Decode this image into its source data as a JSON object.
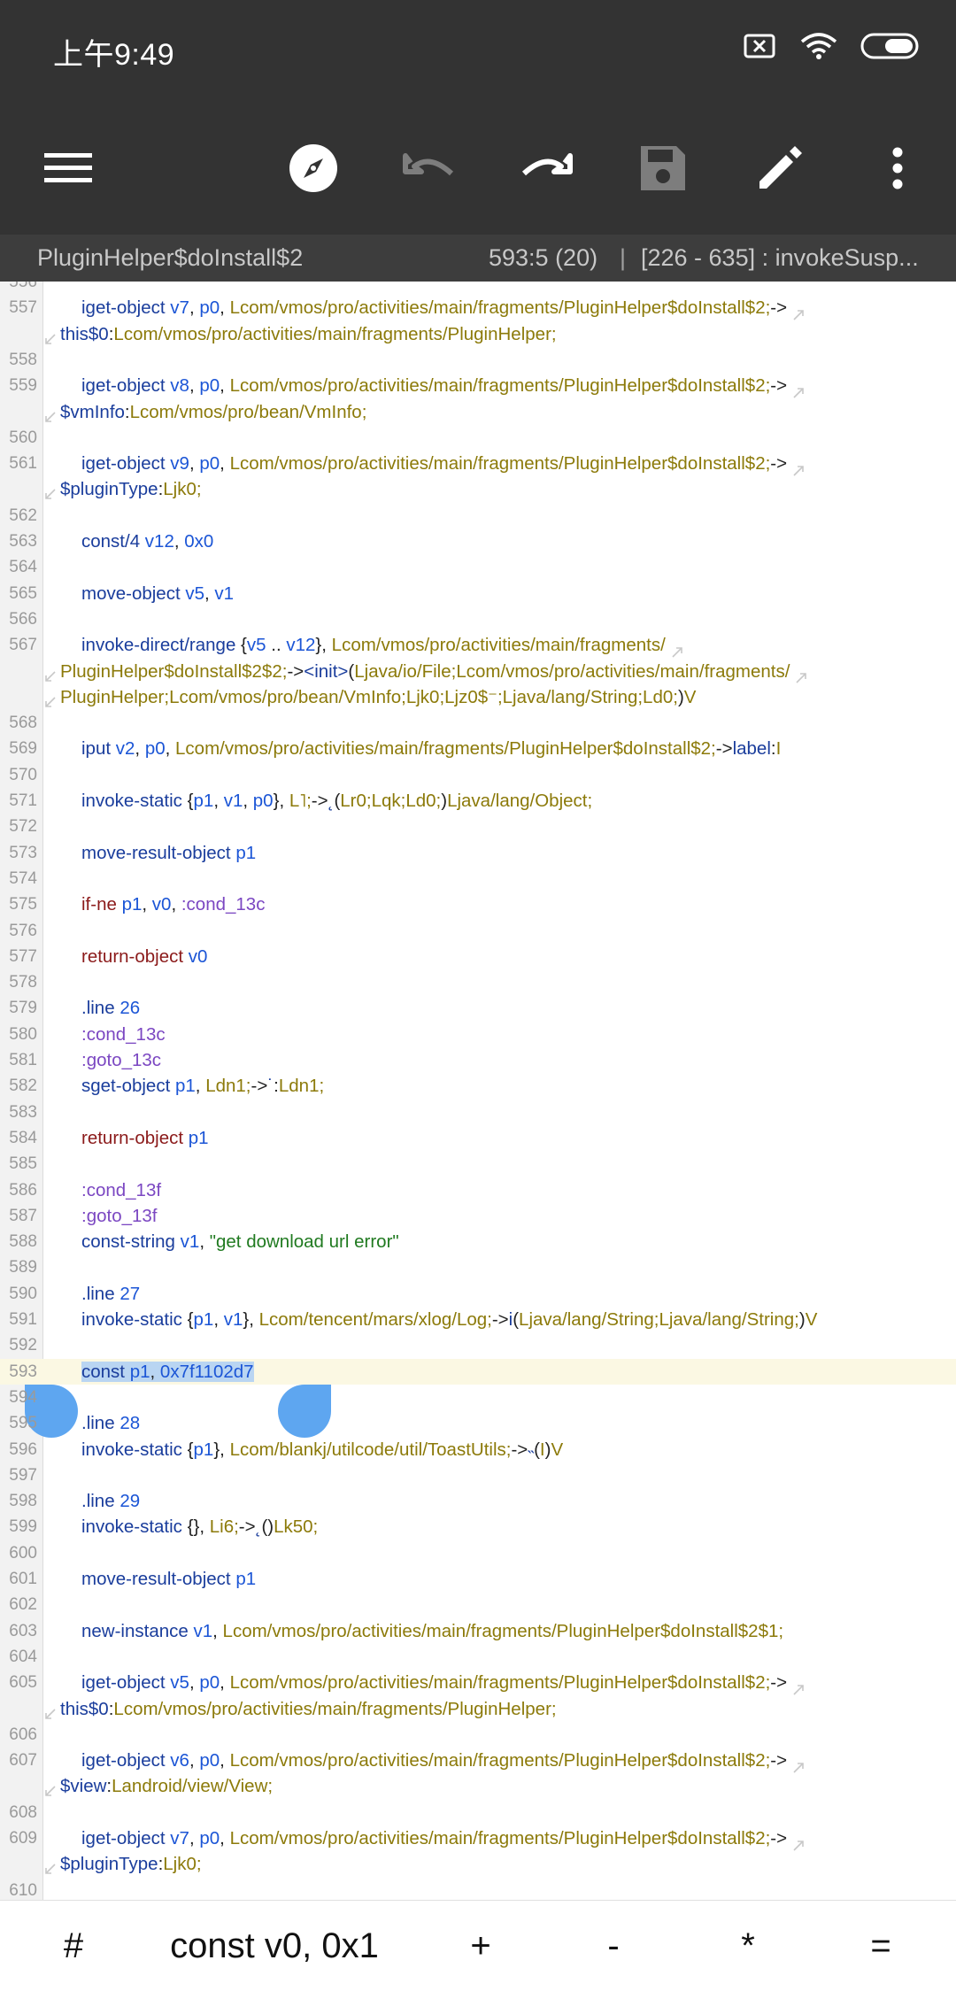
{
  "status_bar": {
    "time": "上午9:49"
  },
  "toolbar": {
    "icons": [
      "menu-icon",
      "compass-icon",
      "undo-icon",
      "redo-icon",
      "save-icon",
      "edit-icon",
      "more-vert-icon"
    ]
  },
  "info_bar": {
    "file_name": "PluginHelper$doInstall$2",
    "position": "593:5 (20)",
    "separator": "|",
    "range": "[226 - 635] : invokeSusp..."
  },
  "editor": {
    "first_partial_line_number": "556",
    "last_partial_line_number": "610",
    "selected_line_number": "593",
    "handle_line_number": "594",
    "lines": [
      {
        "n": "557",
        "segs": [
          [
            "kw",
            "iget-object "
          ],
          [
            "reg",
            "v7"
          ],
          [
            "pun",
            ", "
          ],
          [
            "reg",
            "p0"
          ],
          [
            "pun",
            ", "
          ],
          [
            "type",
            "Lcom/vmos/pro/activities/main/fragments/PluginHelper$doInstall$2;"
          ],
          [
            "pun",
            "->"
          ]
        ],
        "wrap": [
          [
            [
              "field",
              "this$0"
            ],
            [
              "pun",
              ":"
            ],
            [
              "type",
              "Lcom/vmos/pro/activities/main/fragments/PluginHelper;"
            ]
          ]
        ]
      },
      {
        "n": "558",
        "segs": []
      },
      {
        "n": "559",
        "segs": [
          [
            "kw",
            "iget-object "
          ],
          [
            "reg",
            "v8"
          ],
          [
            "pun",
            ", "
          ],
          [
            "reg",
            "p0"
          ],
          [
            "pun",
            ", "
          ],
          [
            "type",
            "Lcom/vmos/pro/activities/main/fragments/PluginHelper$doInstall$2;"
          ],
          [
            "pun",
            "->"
          ]
        ],
        "wrap": [
          [
            [
              "field",
              "$vmInfo"
            ],
            [
              "pun",
              ":"
            ],
            [
              "type",
              "Lcom/vmos/pro/bean/VmInfo;"
            ]
          ]
        ]
      },
      {
        "n": "560",
        "segs": []
      },
      {
        "n": "561",
        "segs": [
          [
            "kw",
            "iget-object "
          ],
          [
            "reg",
            "v9"
          ],
          [
            "pun",
            ", "
          ],
          [
            "reg",
            "p0"
          ],
          [
            "pun",
            ", "
          ],
          [
            "type",
            "Lcom/vmos/pro/activities/main/fragments/PluginHelper$doInstall$2;"
          ],
          [
            "pun",
            "->"
          ]
        ],
        "wrap": [
          [
            [
              "field",
              "$pluginType"
            ],
            [
              "pun",
              ":"
            ],
            [
              "type",
              "Ljk0;"
            ]
          ]
        ]
      },
      {
        "n": "562",
        "segs": []
      },
      {
        "n": "563",
        "segs": [
          [
            "kw",
            "const/4 "
          ],
          [
            "reg",
            "v12"
          ],
          [
            "pun",
            ", "
          ],
          [
            "num",
            "0x0"
          ]
        ]
      },
      {
        "n": "564",
        "segs": []
      },
      {
        "n": "565",
        "segs": [
          [
            "kw",
            "move-object "
          ],
          [
            "reg",
            "v5"
          ],
          [
            "pun",
            ", "
          ],
          [
            "reg",
            "v1"
          ]
        ]
      },
      {
        "n": "566",
        "segs": []
      },
      {
        "n": "567",
        "segs": [
          [
            "kw",
            "invoke-direct/range "
          ],
          [
            "pun",
            "{"
          ],
          [
            "reg",
            "v5"
          ],
          [
            "pun",
            " .. "
          ],
          [
            "reg",
            "v12"
          ],
          [
            "pun",
            "}, "
          ],
          [
            "type",
            "Lcom/vmos/pro/activities/main/fragments/"
          ]
        ],
        "wrap": [
          [
            [
              "type",
              "PluginHelper$doInstall$2$2;"
            ],
            [
              "pun",
              "->"
            ],
            [
              "field",
              "<init>"
            ],
            [
              "pun",
              "("
            ],
            [
              "type",
              "Ljava/io/File;Lcom/vmos/pro/activities/main/fragments/"
            ]
          ],
          [
            [
              "type",
              "PluginHelper;Lcom/vmos/pro/bean/VmInfo;Ljk0;Ljz0$⁻;Ljava/lang/String;Ld0;"
            ],
            [
              "pun",
              ")"
            ],
            [
              "type",
              "V"
            ]
          ]
        ]
      },
      {
        "n": "568",
        "segs": []
      },
      {
        "n": "569",
        "segs": [
          [
            "kw",
            "iput "
          ],
          [
            "reg",
            "v2"
          ],
          [
            "pun",
            ", "
          ],
          [
            "reg",
            "p0"
          ],
          [
            "pun",
            ", "
          ],
          [
            "type",
            "Lcom/vmos/pro/activities/main/fragments/PluginHelper$doInstall$2;"
          ],
          [
            "pun",
            "->"
          ],
          [
            "field",
            "label"
          ],
          [
            "pun",
            ":"
          ],
          [
            "type",
            "I"
          ]
        ]
      },
      {
        "n": "570",
        "segs": []
      },
      {
        "n": "571",
        "segs": [
          [
            "kw",
            "invoke-static "
          ],
          [
            "pun",
            "{"
          ],
          [
            "reg",
            "p1"
          ],
          [
            "pun",
            ", "
          ],
          [
            "reg",
            "v1"
          ],
          [
            "pun",
            ", "
          ],
          [
            "reg",
            "p0"
          ],
          [
            "pun",
            "}, "
          ],
          [
            "type",
            "L˥;"
          ],
          [
            "pun",
            "->"
          ],
          [
            "field",
            "˛"
          ],
          [
            "pun",
            "("
          ],
          [
            "type",
            "Lr0;Lqk;Ld0;"
          ],
          [
            "pun",
            ")"
          ],
          [
            "type",
            "Ljava/lang/Object;"
          ]
        ]
      },
      {
        "n": "572",
        "segs": []
      },
      {
        "n": "573",
        "segs": [
          [
            "kw",
            "move-result-object "
          ],
          [
            "reg",
            "p1"
          ]
        ]
      },
      {
        "n": "574",
        "segs": []
      },
      {
        "n": "575",
        "segs": [
          [
            "kw-ret",
            "if-ne "
          ],
          [
            "reg",
            "p1"
          ],
          [
            "pun",
            ", "
          ],
          [
            "reg",
            "v0"
          ],
          [
            "pun",
            ", "
          ],
          [
            "label",
            ":cond_13c"
          ]
        ]
      },
      {
        "n": "576",
        "segs": []
      },
      {
        "n": "577",
        "segs": [
          [
            "kw-ret",
            "return-object "
          ],
          [
            "reg",
            "v0"
          ]
        ]
      },
      {
        "n": "578",
        "segs": []
      },
      {
        "n": "579",
        "segs": [
          [
            "kw-dir",
            ".line "
          ],
          [
            "num",
            "26"
          ]
        ]
      },
      {
        "n": "580",
        "segs": [
          [
            "label",
            ":cond_13c"
          ]
        ]
      },
      {
        "n": "581",
        "segs": [
          [
            "label",
            ":goto_13c"
          ]
        ]
      },
      {
        "n": "582",
        "segs": [
          [
            "kw",
            "sget-object "
          ],
          [
            "reg",
            "p1"
          ],
          [
            "pun",
            ", "
          ],
          [
            "type",
            "Ldn1;"
          ],
          [
            "pun",
            "->"
          ],
          [
            "field",
            "˙"
          ],
          [
            "pun",
            ":"
          ],
          [
            "type",
            "Ldn1;"
          ]
        ]
      },
      {
        "n": "583",
        "segs": []
      },
      {
        "n": "584",
        "segs": [
          [
            "kw-ret",
            "return-object "
          ],
          [
            "reg",
            "p1"
          ]
        ]
      },
      {
        "n": "585",
        "segs": []
      },
      {
        "n": "586",
        "segs": [
          [
            "label",
            ":cond_13f"
          ]
        ]
      },
      {
        "n": "587",
        "segs": [
          [
            "label",
            ":goto_13f"
          ]
        ]
      },
      {
        "n": "588",
        "segs": [
          [
            "kw",
            "const-string "
          ],
          [
            "reg",
            "v1"
          ],
          [
            "pun",
            ", "
          ],
          [
            "str",
            "\"get download url error\""
          ]
        ]
      },
      {
        "n": "589",
        "segs": []
      },
      {
        "n": "590",
        "segs": [
          [
            "kw-dir",
            ".line "
          ],
          [
            "num",
            "27"
          ]
        ]
      },
      {
        "n": "591",
        "segs": [
          [
            "kw",
            "invoke-static "
          ],
          [
            "pun",
            "{"
          ],
          [
            "reg",
            "p1"
          ],
          [
            "pun",
            ", "
          ],
          [
            "reg",
            "v1"
          ],
          [
            "pun",
            "}, "
          ],
          [
            "type",
            "Lcom/tencent/mars/xlog/Log;"
          ],
          [
            "pun",
            "->"
          ],
          [
            "field",
            "i"
          ],
          [
            "pun",
            "("
          ],
          [
            "type",
            "Ljava/lang/String;Ljava/lang/String;"
          ],
          [
            "pun",
            ")"
          ],
          [
            "type",
            "V"
          ]
        ]
      },
      {
        "n": "592",
        "segs": []
      },
      {
        "n": "593",
        "current": true,
        "segs": [
          [
            "kw sel",
            "const "
          ],
          [
            "reg sel",
            "p1"
          ],
          [
            "pun sel",
            ", "
          ],
          [
            "num sel",
            "0x7f1102d7"
          ]
        ]
      },
      {
        "n": "594",
        "segs": []
      },
      {
        "n": "595",
        "segs": [
          [
            "kw-dir",
            ".line "
          ],
          [
            "num",
            "28"
          ]
        ]
      },
      {
        "n": "596",
        "segs": [
          [
            "kw",
            "invoke-static "
          ],
          [
            "pun",
            "{"
          ],
          [
            "reg",
            "p1"
          ],
          [
            "pun",
            "}, "
          ],
          [
            "type",
            "Lcom/blankj/utilcode/util/ToastUtils;"
          ],
          [
            "pun",
            "->"
          ],
          [
            "field",
            "˵"
          ],
          [
            "pun",
            "("
          ],
          [
            "type",
            "I"
          ],
          [
            "pun",
            ")"
          ],
          [
            "type",
            "V"
          ]
        ]
      },
      {
        "n": "597",
        "segs": []
      },
      {
        "n": "598",
        "segs": [
          [
            "kw-dir",
            ".line "
          ],
          [
            "num",
            "29"
          ]
        ]
      },
      {
        "n": "599",
        "segs": [
          [
            "kw",
            "invoke-static "
          ],
          [
            "pun",
            "{}, "
          ],
          [
            "type",
            "Li6;"
          ],
          [
            "pun",
            "->"
          ],
          [
            "field",
            "˛"
          ],
          [
            "pun",
            "()"
          ],
          [
            "type",
            "Lk50;"
          ]
        ]
      },
      {
        "n": "600",
        "segs": []
      },
      {
        "n": "601",
        "segs": [
          [
            "kw",
            "move-result-object "
          ],
          [
            "reg",
            "p1"
          ]
        ]
      },
      {
        "n": "602",
        "segs": []
      },
      {
        "n": "603",
        "segs": [
          [
            "kw",
            "new-instance "
          ],
          [
            "reg",
            "v1"
          ],
          [
            "pun",
            ", "
          ],
          [
            "type",
            "Lcom/vmos/pro/activities/main/fragments/PluginHelper$doInstall$2$1;"
          ]
        ]
      },
      {
        "n": "604",
        "segs": []
      },
      {
        "n": "605",
        "segs": [
          [
            "kw",
            "iget-object "
          ],
          [
            "reg",
            "v5"
          ],
          [
            "pun",
            ", "
          ],
          [
            "reg",
            "p0"
          ],
          [
            "pun",
            ", "
          ],
          [
            "type",
            "Lcom/vmos/pro/activities/main/fragments/PluginHelper$doInstall$2;"
          ],
          [
            "pun",
            "->"
          ]
        ],
        "wrap": [
          [
            [
              "field",
              "this$0"
            ],
            [
              "pun",
              ":"
            ],
            [
              "type",
              "Lcom/vmos/pro/activities/main/fragments/PluginHelper;"
            ]
          ]
        ]
      },
      {
        "n": "606",
        "segs": []
      },
      {
        "n": "607",
        "segs": [
          [
            "kw",
            "iget-object "
          ],
          [
            "reg",
            "v6"
          ],
          [
            "pun",
            ", "
          ],
          [
            "reg",
            "p0"
          ],
          [
            "pun",
            ", "
          ],
          [
            "type",
            "Lcom/vmos/pro/activities/main/fragments/PluginHelper$doInstall$2;"
          ],
          [
            "pun",
            "->"
          ]
        ],
        "wrap": [
          [
            [
              "field",
              "$view"
            ],
            [
              "pun",
              ":"
            ],
            [
              "type",
              "Landroid/view/View;"
            ]
          ]
        ]
      },
      {
        "n": "608",
        "segs": []
      },
      {
        "n": "609",
        "segs": [
          [
            "kw",
            "iget-object "
          ],
          [
            "reg",
            "v7"
          ],
          [
            "pun",
            ", "
          ],
          [
            "reg",
            "p0"
          ],
          [
            "pun",
            ", "
          ],
          [
            "type",
            "Lcom/vmos/pro/activities/main/fragments/PluginHelper$doInstall$2;"
          ],
          [
            "pun",
            "->"
          ]
        ],
        "wrap": [
          [
            [
              "field",
              "$pluginType"
            ],
            [
              "pun",
              ":"
            ],
            [
              "type",
              "Ljk0;"
            ]
          ]
        ]
      }
    ]
  },
  "bottom_bar": {
    "items": [
      "#",
      "const v0, 0x1",
      "+",
      "-",
      "*",
      "="
    ]
  }
}
